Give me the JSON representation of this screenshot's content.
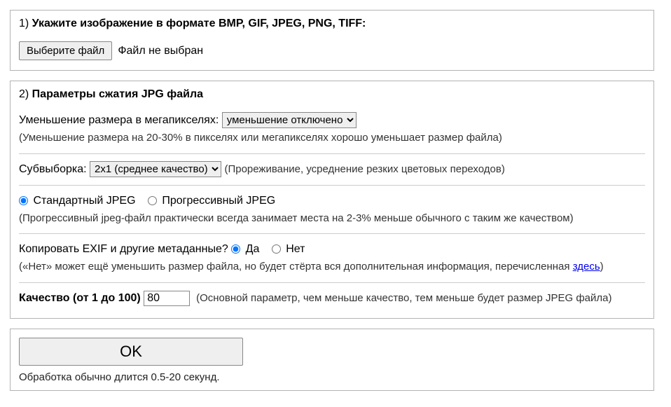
{
  "section1": {
    "num": "1) ",
    "title": "Укажите изображение в формате BMP, GIF, JPEG, PNG, TIFF:",
    "choose_btn": "Выберите файл",
    "no_file": "Файл не выбран"
  },
  "section2": {
    "num": "2) ",
    "title": "Параметры сжатия JPG файла",
    "resize_label": "Уменьшение размера в мегапикселях: ",
    "resize_selected": "уменьшение отключено",
    "resize_hint": "(Уменьшение размера на 20-30% в пикселях или мегапикселях хорошо уменьшает размер файла)",
    "subsample_label": "Субвыборка: ",
    "subsample_selected": "2x1 (среднее качество)",
    "subsample_hint": "(Прореживание, усреднение резких цветовых переходов)",
    "jpeg_standard": "Стандартный JPEG",
    "jpeg_progressive": "Прогрессивный JPEG",
    "jpeg_hint": "(Прогрессивный jpeg-файл практически всегда занимает места на 2-3% меньше обычного с таким же качеством)",
    "exif_label": "Копировать EXIF и другие метаданные? ",
    "exif_yes": "Да",
    "exif_no": "Нет",
    "exif_hint_pre": "(«Нет» может ещё уменьшить размер файла, но будет стёрта вся дополнительная информация, перечисленная ",
    "exif_hint_link": "здесь",
    "exif_hint_post": ")",
    "quality_label": "Качество (от 1 до 100) ",
    "quality_value": "80",
    "quality_hint": "(Основной параметр, чем меньше качество, тем меньше будет размер JPEG файла)"
  },
  "submit": {
    "ok": "OK",
    "hint": "Обработка обычно длится 0.5-20 секунд."
  }
}
